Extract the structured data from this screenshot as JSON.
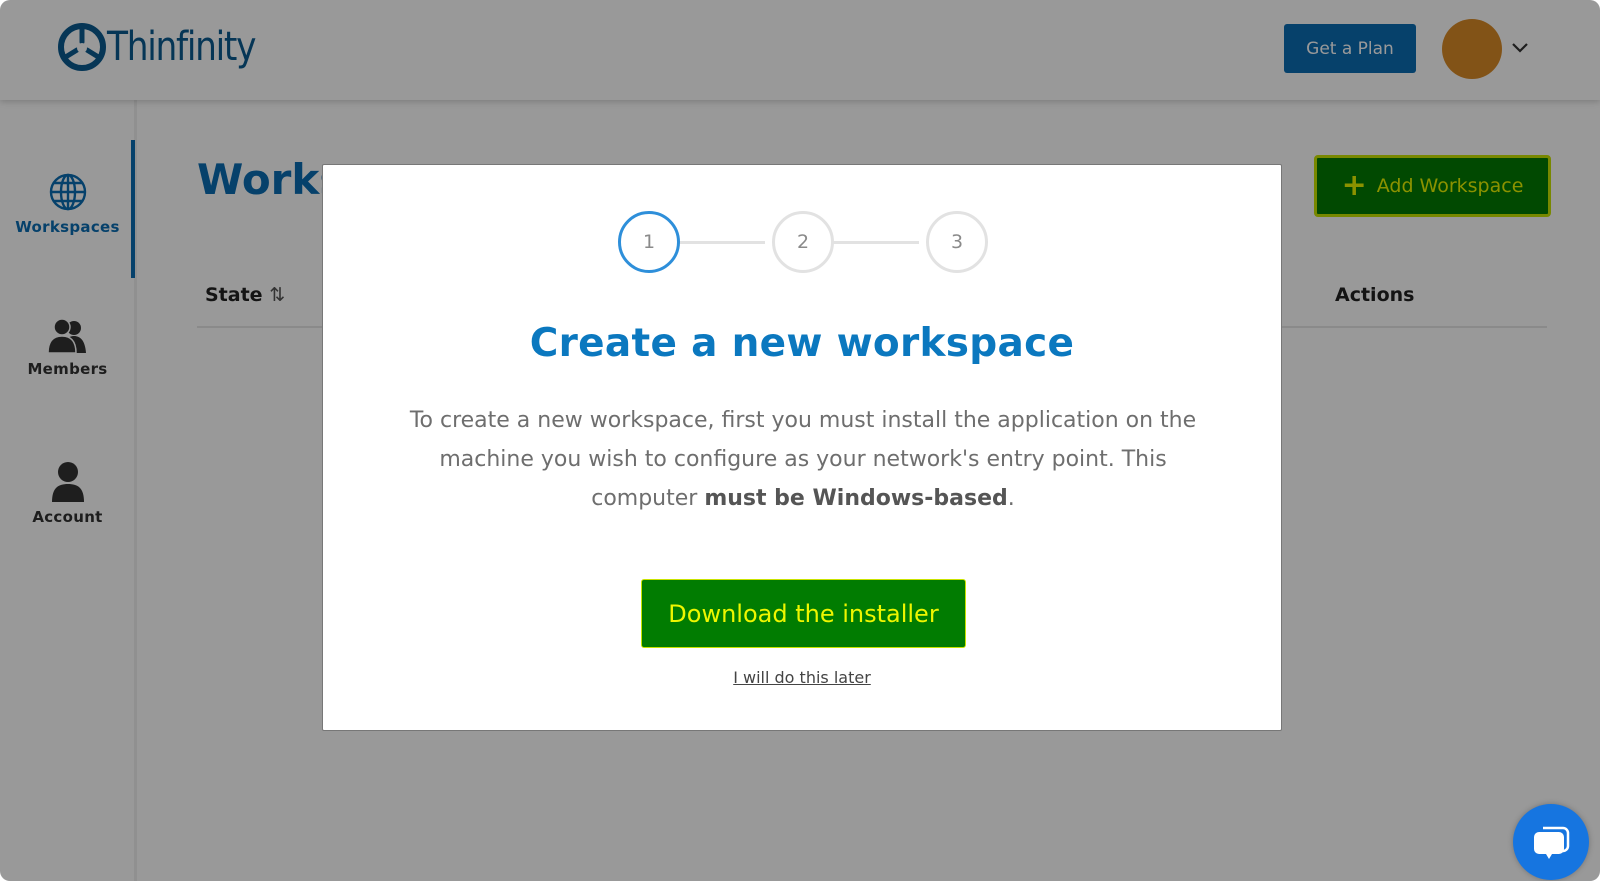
{
  "header": {
    "logo_text": "Thinfinity",
    "get_plan_label": "Get a Plan",
    "avatar_color": "#d98a27"
  },
  "sidebar": {
    "items": [
      {
        "label": "Workspaces",
        "icon": "globe-icon",
        "active": true
      },
      {
        "label": "Members",
        "icon": "users-icon",
        "active": false
      },
      {
        "label": "Account",
        "icon": "user-icon",
        "active": false
      }
    ]
  },
  "main": {
    "title": "Workspaces",
    "add_button_label": "Add Workspace",
    "table": {
      "columns": [
        "State",
        "Actions"
      ],
      "sort_icon": "⇅"
    }
  },
  "modal": {
    "steps": [
      "1",
      "2",
      "3"
    ],
    "active_step": 1,
    "title": "Create a new workspace",
    "body_prefix": "To create a new workspace, first you must install the application on the machine you wish to configure as your network's entry point. This computer ",
    "body_bold": "must be Windows-based",
    "body_suffix": ".",
    "primary_button": "Download the installer",
    "secondary_link": "I will do this later"
  },
  "colors": {
    "brand": "#0b6db3",
    "accent_green": "#017c01",
    "accent_yellow": "#eef600",
    "step_active": "#2e8fda",
    "chat": "#1675e0"
  }
}
